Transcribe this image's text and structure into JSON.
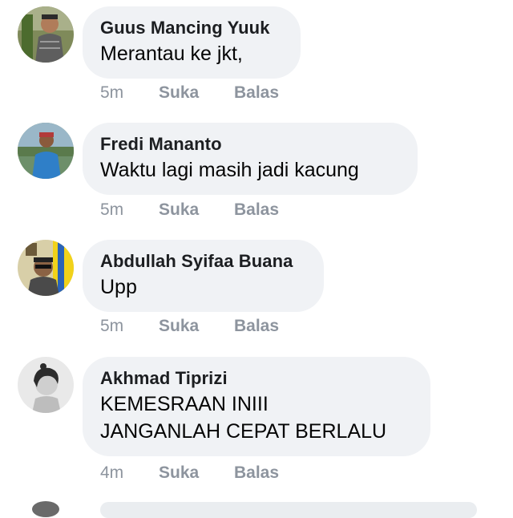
{
  "comments": [
    {
      "name": "Guus Mancing Yuuk",
      "lines": [
        "Merantau ke jkt,"
      ],
      "time": "5m",
      "like_label": "Suka",
      "reply_label": "Balas",
      "avatar": "guus-avatar"
    },
    {
      "name": "Fredi Mananto",
      "lines": [
        "Waktu lagi masih jadi kacung"
      ],
      "time": "5m",
      "like_label": "Suka",
      "reply_label": "Balas",
      "avatar": "fredi-avatar"
    },
    {
      "name": "Abdullah Syifaa Buana",
      "lines": [
        "Upp"
      ],
      "time": "5m",
      "like_label": "Suka",
      "reply_label": "Balas",
      "avatar": "abdullah-avatar"
    },
    {
      "name": "Akhmad Tiprizi",
      "lines": [
        "KEMESRAAN INIII",
        "JANGANLAH CEPAT BERLALU"
      ],
      "time": "4m",
      "like_label": "Suka",
      "reply_label": "Balas",
      "avatar": "akhmad-avatar"
    }
  ],
  "colors": {
    "bubble": "#f0f2f5",
    "name": "#1c1e21",
    "meta": "#8d949e"
  }
}
